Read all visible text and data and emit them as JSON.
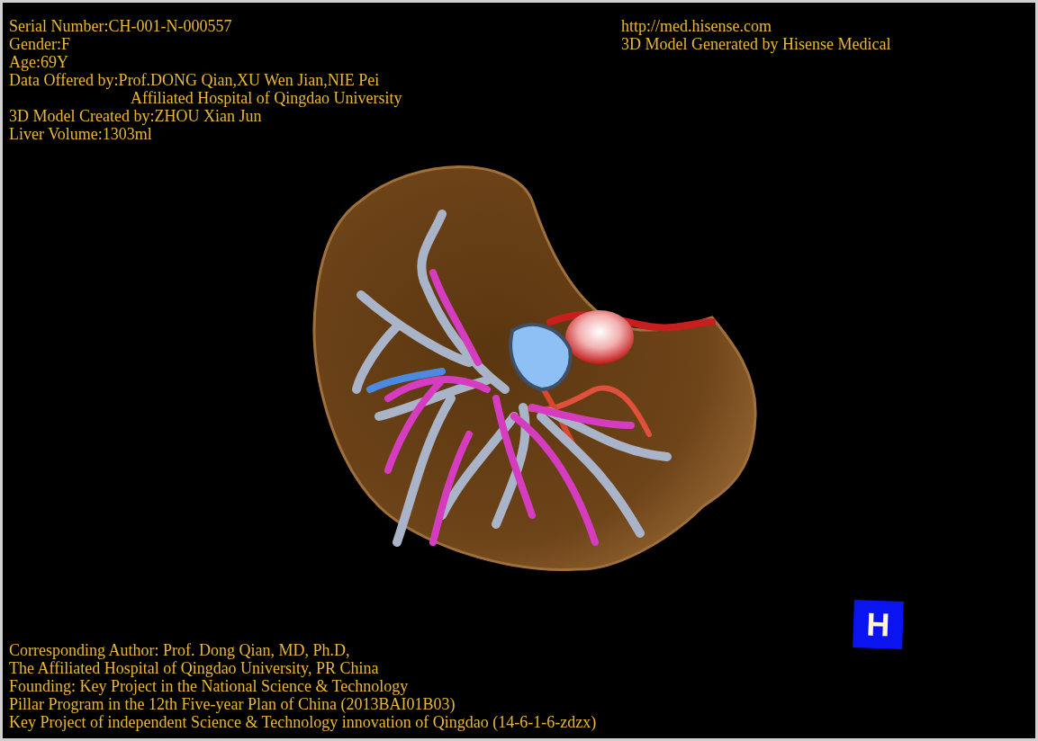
{
  "header_left": [
    {
      "text": "Serial Number:CH-001-N-000557",
      "kind": "line"
    },
    {
      "text": "Gender:F",
      "kind": "line"
    },
    {
      "text": "Age:69Y",
      "kind": "line"
    },
    {
      "text": "Data Offered by:Prof.DONG Qian,XU Wen Jian,NIE Pei",
      "kind": "line"
    },
    {
      "text": "Affiliated Hospital of Qingdao University",
      "kind": "indented"
    },
    {
      "text": "3D Model Created by:ZHOU Xian Jun",
      "kind": "line"
    },
    {
      "text": "Liver Volume:1303ml",
      "kind": "line"
    }
  ],
  "header_right": [
    "http://med.hisense.com",
    "3D Model Generated by Hisense Medical"
  ],
  "orientation_marker": {
    "label": "H"
  },
  "footer": [
    "Corresponding Author: Prof. Dong Qian, MD, Ph.D,",
    "The Affiliated Hospital of Qingdao University, PR China",
    "Founding: Key Project in the National Science & Technology",
    "Pillar Program in the 12th Five-year Plan of China (2013BAI01B03)",
    "Key Project of independent Science & Technology innovation of Qingdao (14-6-1-6-zdzx)"
  ]
}
